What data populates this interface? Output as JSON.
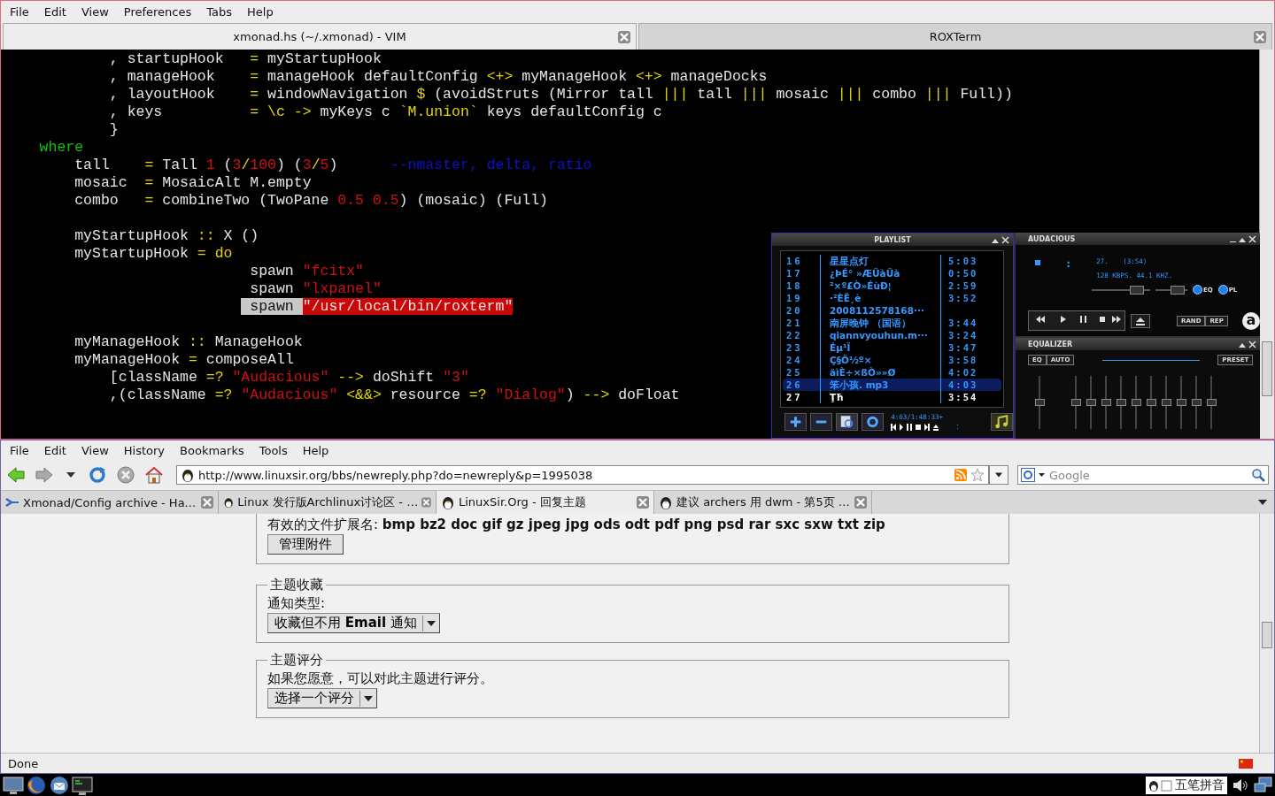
{
  "terminal_window": {
    "menu": [
      "File",
      "Edit",
      "View",
      "Preferences",
      "Tabs",
      "Help"
    ],
    "tabs": [
      {
        "label": "xmonad.hs (~/.xmonad) - VIM",
        "selected": true
      },
      {
        "label": "ROXTerm",
        "selected": false
      }
    ],
    "lines": [
      {
        "kind": "code",
        "segments": [
          {
            "text": "            , startupHook   ",
            "kind": "plain"
          },
          {
            "text": "=",
            "kind": "op"
          },
          {
            "text": " myStartupHook",
            "kind": "plain"
          }
        ]
      },
      {
        "kind": "code",
        "segments": [
          {
            "text": "            , manageHook    ",
            "kind": "plain"
          },
          {
            "text": "=",
            "kind": "op"
          },
          {
            "text": " manageHook defaultConfig ",
            "kind": "plain"
          },
          {
            "text": "<+>",
            "kind": "op"
          },
          {
            "text": " myManageHook ",
            "kind": "plain"
          },
          {
            "text": "<+>",
            "kind": "op"
          },
          {
            "text": " manageDocks",
            "kind": "plain"
          }
        ]
      },
      {
        "kind": "code",
        "segments": [
          {
            "text": "            , layoutHook    ",
            "kind": "plain"
          },
          {
            "text": "=",
            "kind": "op"
          },
          {
            "text": " windowNavigation ",
            "kind": "plain"
          },
          {
            "text": "$",
            "kind": "op"
          },
          {
            "text": " (avoidStruts (Mirror tall ",
            "kind": "plain"
          },
          {
            "text": "|||",
            "kind": "op"
          },
          {
            "text": " tall ",
            "kind": "plain"
          },
          {
            "text": "|||",
            "kind": "op"
          },
          {
            "text": " mosaic ",
            "kind": "plain"
          },
          {
            "text": "|||",
            "kind": "op"
          },
          {
            "text": " combo ",
            "kind": "plain"
          },
          {
            "text": "|||",
            "kind": "op"
          },
          {
            "text": " Full))",
            "kind": "plain"
          }
        ]
      },
      {
        "kind": "code",
        "segments": [
          {
            "text": "            , keys          ",
            "kind": "plain"
          },
          {
            "text": "= ",
            "kind": "op"
          },
          {
            "text": "\\c ->",
            "kind": "op"
          },
          {
            "text": " myKeys c ",
            "kind": "plain"
          },
          {
            "text": "`M.union`",
            "kind": "op"
          },
          {
            "text": " keys defaultConfig c",
            "kind": "plain"
          }
        ]
      },
      {
        "kind": "code",
        "segments": [
          {
            "text": "            }",
            "kind": "plain"
          }
        ]
      },
      {
        "kind": "code",
        "segments": [
          {
            "text": "    where",
            "kind": "kw"
          }
        ]
      },
      {
        "kind": "code",
        "segments": [
          {
            "text": "        tall    ",
            "kind": "plain"
          },
          {
            "text": "=",
            "kind": "op"
          },
          {
            "text": " Tall ",
            "kind": "plain"
          },
          {
            "text": "1",
            "kind": "num"
          },
          {
            "text": " (",
            "kind": "plain"
          },
          {
            "text": "3",
            "kind": "num"
          },
          {
            "text": "/",
            "kind": "op"
          },
          {
            "text": "100",
            "kind": "num"
          },
          {
            "text": ") (",
            "kind": "plain"
          },
          {
            "text": "3",
            "kind": "num"
          },
          {
            "text": "/",
            "kind": "op"
          },
          {
            "text": "5",
            "kind": "num"
          },
          {
            "text": ")      ",
            "kind": "plain"
          },
          {
            "text": "--nmaster, delta, ratio",
            "kind": "cmt"
          }
        ]
      },
      {
        "kind": "code",
        "segments": [
          {
            "text": "        mosaic  ",
            "kind": "plain"
          },
          {
            "text": "=",
            "kind": "op"
          },
          {
            "text": " MosaicAlt M.empty",
            "kind": "plain"
          }
        ]
      },
      {
        "kind": "code",
        "segments": [
          {
            "text": "        combo   ",
            "kind": "plain"
          },
          {
            "text": "=",
            "kind": "op"
          },
          {
            "text": " combineTwo (TwoPane ",
            "kind": "plain"
          },
          {
            "text": "0.5 ",
            "kind": "num"
          },
          {
            "text": "0.5",
            "kind": "num"
          },
          {
            "text": ") (mosaic) (Full)",
            "kind": "plain"
          }
        ]
      },
      {
        "kind": "blank"
      },
      {
        "kind": "code",
        "segments": [
          {
            "text": "        myStartupHook ",
            "kind": "plain"
          },
          {
            "text": "::",
            "kind": "op"
          },
          {
            "text": " X ()",
            "kind": "plain"
          }
        ]
      },
      {
        "kind": "code",
        "segments": [
          {
            "text": "        myStartupHook ",
            "kind": "plain"
          },
          {
            "text": "= do",
            "kind": "op"
          }
        ]
      },
      {
        "kind": "code",
        "segments": [
          {
            "text": "                            spawn ",
            "kind": "plain"
          },
          {
            "text": "\"fcitx\"",
            "kind": "str"
          }
        ]
      },
      {
        "kind": "code",
        "segments": [
          {
            "text": "                            spawn ",
            "kind": "plain"
          },
          {
            "text": "\"lxpanel\"",
            "kind": "str"
          }
        ]
      },
      {
        "kind": "code",
        "segments": [
          {
            "text": "                            spawn ",
            "kind": "sel"
          },
          {
            "text": "\"/usr/local/bin/roxterm\"",
            "kind": "err"
          }
        ]
      },
      {
        "kind": "blank"
      },
      {
        "kind": "code",
        "segments": [
          {
            "text": "        myManageHook ",
            "kind": "plain"
          },
          {
            "text": "::",
            "kind": "op"
          },
          {
            "text": " ManageHook",
            "kind": "plain"
          }
        ]
      },
      {
        "kind": "code",
        "segments": [
          {
            "text": "        myManageHook ",
            "kind": "plain"
          },
          {
            "text": "=",
            "kind": "op"
          },
          {
            "text": " composeAll",
            "kind": "plain"
          }
        ]
      },
      {
        "kind": "code",
        "segments": [
          {
            "text": "            [className ",
            "kind": "plain"
          },
          {
            "text": "=? ",
            "kind": "op"
          },
          {
            "text": "\"Audacious\" ",
            "kind": "str"
          },
          {
            "text": "-->",
            "kind": "op"
          },
          {
            "text": " doShift ",
            "kind": "plain"
          },
          {
            "text": "\"3\"",
            "kind": "str"
          }
        ]
      },
      {
        "kind": "code",
        "segments": [
          {
            "text": "            ,(className ",
            "kind": "plain"
          },
          {
            "text": "=? ",
            "kind": "op"
          },
          {
            "text": "\"Audacious\" ",
            "kind": "str"
          },
          {
            "text": "<&&>",
            "kind": "op"
          },
          {
            "text": " resource ",
            "kind": "plain"
          },
          {
            "text": "=? ",
            "kind": "op"
          },
          {
            "text": "\"Dialog\"",
            "kind": "str"
          },
          {
            "text": ") ",
            "kind": "plain"
          },
          {
            "text": "-->",
            "kind": "op"
          },
          {
            "text": " doFloat",
            "kind": "plain"
          }
        ]
      }
    ]
  },
  "audacious": {
    "playlist": {
      "title": "PLAYLIST",
      "items": [
        {
          "number": "16",
          "title": "星星点灯",
          "time": "5:03",
          "selected": false,
          "playing": false
        },
        {
          "number": "17",
          "title": "¿ÞÉ° »ÆÜàÜà",
          "time": "0:50",
          "selected": false,
          "playing": false
        },
        {
          "number": "18",
          "title": "²×º£Ò»ÉùÐ¦",
          "time": "2:59",
          "selected": false,
          "playing": false
        },
        {
          "number": "19",
          "title": "·²ÈË¸è",
          "time": "3:52",
          "selected": false,
          "playing": false
        },
        {
          "number": "20",
          "title": "2008112578168···",
          "selected": false,
          "playing": false
        },
        {
          "number": "21",
          "title": "南屏晚钟 （国语）",
          "time": "3:44",
          "selected": false,
          "playing": false
        },
        {
          "number": "22",
          "title": "qiannvyouhun.m···",
          "time": "3:24",
          "selected": false,
          "playing": false
        },
        {
          "number": "23",
          "title": "Éµ¹Ï",
          "time": "3:47",
          "selected": false,
          "playing": false
        },
        {
          "number": "24",
          "title": "Ç§Ö½º×",
          "time": "3:58",
          "selected": false,
          "playing": false
        },
        {
          "number": "25",
          "title": "äìÈ÷×ßÒ»»Ø",
          "time": "4:02",
          "selected": false,
          "playing": false
        },
        {
          "number": "26",
          "title": "笨小孩. mp3",
          "time": "4:03",
          "selected": true,
          "playing": false
        },
        {
          "number": "27",
          "title": "Ţħ",
          "time": "3:54",
          "selected": false,
          "playing": true
        }
      ],
      "position": "4:03/1:48:33+",
      "mini_time": ":"
    },
    "player": {
      "title": "AUDACIOUS",
      "time": ":",
      "track": "27.",
      "length": "(3:54)",
      "info": "128 KBPS. 44.1 KHZ.",
      "volume": {
        "level": 0.85
      },
      "balance": {
        "level": 0.85
      },
      "toggles": [
        {
          "label": "EQ",
          "on": true
        },
        {
          "label": "PL",
          "on": true
        }
      ],
      "buttons": [
        "RAND",
        "REP"
      ],
      "logo": "a"
    },
    "equalizer": {
      "title": "EQUALIZER",
      "buttons": [
        "EQ",
        "AUTO"
      ],
      "preset": "PRESET",
      "preamp": {
        "level": 0.5
      },
      "bands": [
        {
          "level": 0.5
        },
        {
          "level": 0.5
        },
        {
          "level": 0.5
        },
        {
          "level": 0.5
        },
        {
          "level": 0.5
        },
        {
          "level": 0.5
        },
        {
          "level": 0.5
        },
        {
          "level": 0.5
        },
        {
          "level": 0.5
        },
        {
          "level": 0.5
        }
      ]
    }
  },
  "browser": {
    "menu": [
      "File",
      "Edit",
      "View",
      "History",
      "Bookmarks",
      "Tools",
      "Help"
    ],
    "url": "http://www.linuxsir.org/bbs/newreply.php?do=newreply&p=1995038",
    "search": {
      "placeholder": "Google"
    },
    "tabs": [
      {
        "label": "Xmonad/Config archive - Ha...",
        "selected": false
      },
      {
        "label": "Linux 发行版Archlinux讨论区 - …",
        "selected": false
      },
      {
        "label": "LinuxSir.Org - 回复主题",
        "selected": true
      },
      {
        "label": "建议 archers 用 dwm - 第5页 …",
        "selected": false
      }
    ],
    "content": {
      "extensions": "有效的文件扩展名: **bmp bz2 doc gif gz jpeg jpg ods odt pdf png psd rar sxc sxw txt zip**",
      "manage_button": "管理附件",
      "fieldsets": [
        {
          "legend": "主题收藏",
          "label": "通知类型:",
          "select": "收藏但不用 **Email** 通知"
        },
        {
          "legend": "主题评分",
          "label": "如果您愿意，可以对此主题进行评分。",
          "select": "选择一个评分"
        }
      ]
    },
    "status": "Done"
  },
  "taskbar": {
    "input_method": "五笔拼音"
  }
}
